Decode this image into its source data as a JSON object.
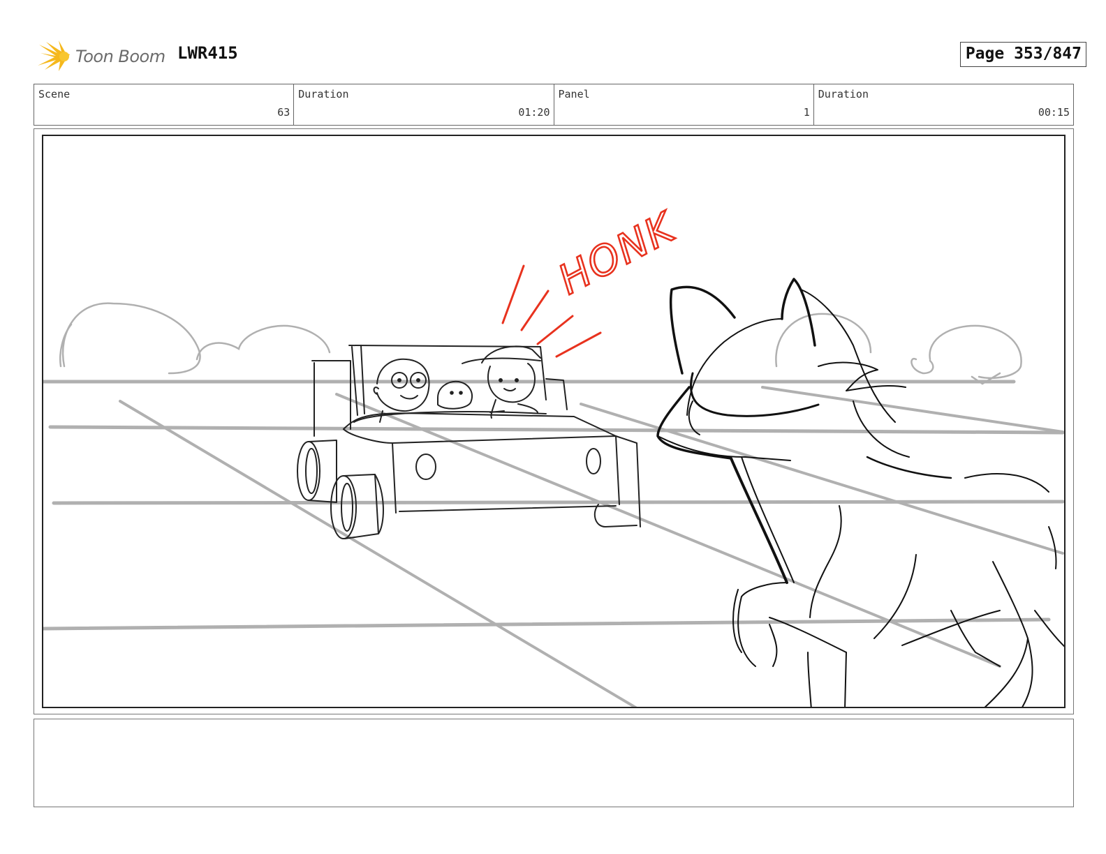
{
  "header": {
    "logo_text": "Toon Boom",
    "logo_icon": "starburst-icon",
    "project": "LWR415",
    "page_label": "Page 353/847"
  },
  "info": {
    "scene_label": "Scene",
    "scene_value": "63",
    "scene_duration_label": "Duration",
    "scene_duration_value": "01:20",
    "panel_label": "Panel",
    "panel_value": "1",
    "panel_duration_label": "Duration",
    "panel_duration_value": "00:15"
  },
  "panel": {
    "sfx_text": "HONK",
    "sfx_color": "#e8321e",
    "line_color": "#111111",
    "guide_color": "#b0b0b0"
  },
  "notes": {
    "text": ""
  }
}
